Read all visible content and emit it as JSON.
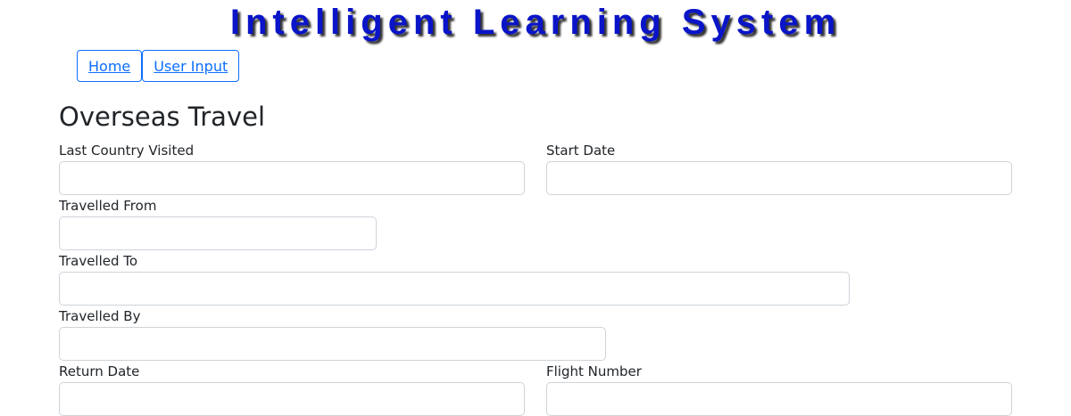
{
  "app": {
    "title": "Intelligent Learning System"
  },
  "nav": {
    "home_label": "Home",
    "user_input_label": "User Input"
  },
  "form": {
    "heading": "Overseas Travel",
    "last_country": {
      "label": "Last Country Visited",
      "value": ""
    },
    "start_date": {
      "label": "Start Date",
      "value": ""
    },
    "travelled_from": {
      "label": "Travelled From",
      "value": ""
    },
    "travelled_to": {
      "label": "Travelled To",
      "value": ""
    },
    "travelled_by": {
      "label": "Travelled By",
      "value": ""
    },
    "return_date": {
      "label": "Return Date",
      "value": ""
    },
    "flight_number": {
      "label": "Flight Number",
      "value": ""
    }
  },
  "colors": {
    "title": "#0a14c8",
    "link": "#0d6efd",
    "input_border": "#ced4da"
  }
}
